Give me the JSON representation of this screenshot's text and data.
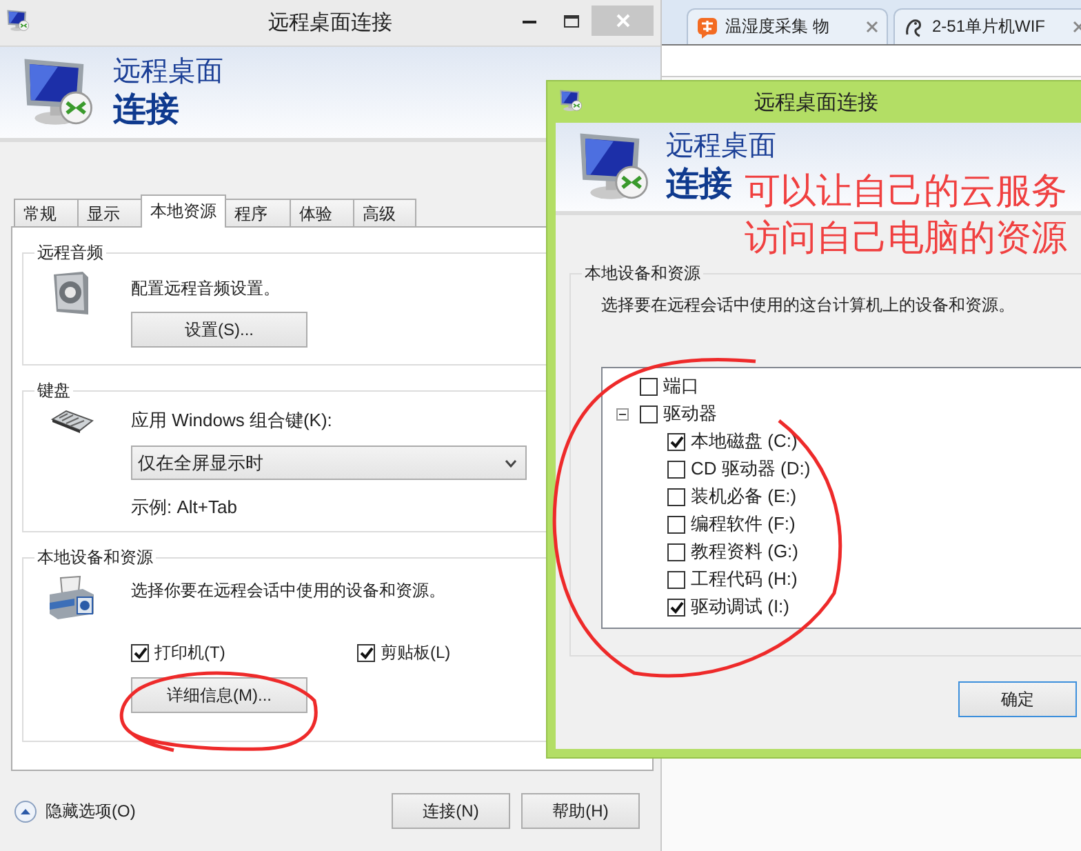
{
  "browser": {
    "tabs": [
      {
        "label": "温湿度采集 物"
      },
      {
        "label": "2-51单片机WIF"
      }
    ]
  },
  "main_window": {
    "title": "远程桌面连接",
    "header": {
      "line1": "远程桌面",
      "line2": "连接"
    },
    "tabs": [
      {
        "label": "常规",
        "selected": false
      },
      {
        "label": "显示",
        "selected": false
      },
      {
        "label": "本地资源",
        "selected": true
      },
      {
        "label": "程序",
        "selected": false
      },
      {
        "label": "体验",
        "selected": false
      },
      {
        "label": "高级",
        "selected": false
      }
    ],
    "groups": [
      {
        "kind": "audio",
        "label": "远程音频",
        "description": "配置远程音频设置。",
        "button": "设置(S)..."
      },
      {
        "kind": "keyboard",
        "label": "键盘",
        "prompt": "应用 Windows 组合键(K):",
        "select_value": "仅在全屏显示时",
        "example": "示例: Alt+Tab"
      },
      {
        "kind": "devices",
        "label": "本地设备和资源",
        "description": "选择你要在远程会话中使用的设备和资源。",
        "checkboxes": [
          {
            "label": "打印机(T)",
            "checked": true
          },
          {
            "label": "剪贴板(L)",
            "checked": true
          }
        ],
        "button": "详细信息(M)..."
      }
    ],
    "footer": {
      "options_toggle": "隐藏选项(O)",
      "buttons": [
        "连接(N)",
        "帮助(H)"
      ]
    }
  },
  "dialog": {
    "title": "远程桌面连接",
    "header": {
      "line1": "远程桌面",
      "line2": "连接"
    },
    "group": {
      "label": "本地设备和资源",
      "description": "选择要在远程会话中使用的这台计算机上的设备和资源。",
      "tree": [
        {
          "label": "端口",
          "checked": false
        },
        {
          "label": "驱动器",
          "checked": false,
          "expanded": true,
          "children": [
            {
              "label": "本地磁盘 (C:)",
              "checked": true
            },
            {
              "label": "CD 驱动器 (D:)",
              "checked": false
            },
            {
              "label": "装机必备 (E:)",
              "checked": false
            },
            {
              "label": "编程软件 (F:)",
              "checked": false
            },
            {
              "label": "教程资料 (G:)",
              "checked": false
            },
            {
              "label": "工程代码 (H:)",
              "checked": false
            },
            {
              "label": "驱动调试 (I:)",
              "checked": true
            }
          ]
        }
      ]
    },
    "buttons": [
      "确定"
    ]
  },
  "annotations": {
    "lines": [
      "可以让自己的云服务",
      "访问自己电脑的资源"
    ]
  }
}
